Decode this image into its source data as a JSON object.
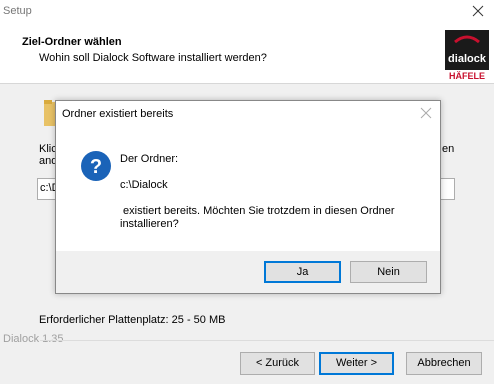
{
  "window": {
    "title": "Setup",
    "header_title": "Ziel-Ordner wählen",
    "header_subtitle": "Wohin soll Dialock Software installiert werden?",
    "logo": {
      "line1": "dialock",
      "line2": "HÄFELE"
    }
  },
  "body": {
    "cut_left_1": "Klick",
    "cut_left_2": "and",
    "cut_right_1": "en",
    "path_value": "c:\\D",
    "disk_space": "Erforderlicher Plattenplatz: 25 - 50 MB"
  },
  "footer": {
    "version": "Dialock 1.35",
    "back_label": "< Zurück",
    "next_label": "Weiter >",
    "cancel_label": "Abbrechen"
  },
  "dialog": {
    "title": "Ordner existiert bereits",
    "line1": "Der Ordner:",
    "folder": "c:\\Dialock",
    "line3": " existiert bereits. Möchten Sie trotzdem in diesen Ordner",
    "line4": "installieren?",
    "yes_label": "Ja",
    "no_label": "Nein",
    "icon": "question-icon"
  },
  "colors": {
    "accent": "#0078d7",
    "logo_red": "#c8102e",
    "question_blue": "#1a63b8"
  }
}
